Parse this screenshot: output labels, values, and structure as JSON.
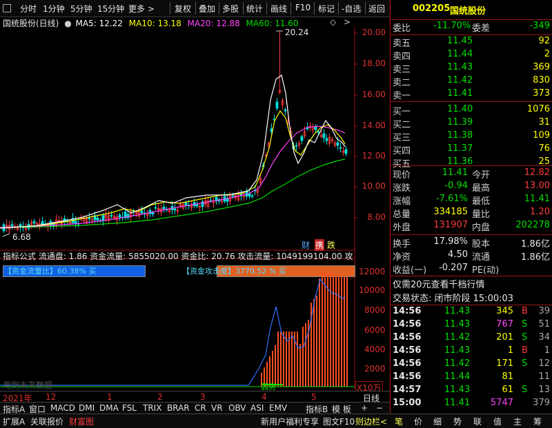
{
  "toolbar": {
    "left_items": [
      "分时",
      "1分钟",
      "5分钟",
      "15分钟",
      "更多 >"
    ],
    "right_items": [
      "复权",
      "叠加",
      "多股",
      "统计",
      "画线",
      "F10",
      "标记",
      "-自选",
      "返回"
    ]
  },
  "legend": {
    "stock_name": "国统股份(日线)",
    "ma5": "MA5: 12.22",
    "ma10": "MA10: 13.18",
    "ma20": "MA20: 12.88",
    "ma60": "MA60: 11.60"
  },
  "price_axis": [
    "20.00",
    "18.00",
    "16.00",
    "14.00",
    "12.00",
    "10.00",
    "8.00"
  ],
  "annotations": {
    "high_label": "20.24",
    "low_label": "6.68"
  },
  "badges": {
    "cai": "财",
    "xie": "携",
    "die": "跌"
  },
  "indicator": {
    "header": "指标公式 流通盘: 1.86 资金流量: 5855020.00 资金比: 20.76 攻击流量: 1049199104.00 攻击",
    "bar1_label": "【资金流量比】60.38% 买",
    "bar2_label": "【资金攻击度】3770.52 % 买",
    "watermark": "用到未来数据",
    "weak_label": "弱势",
    "axis": [
      "12000",
      "10000",
      "8000",
      "6000",
      "4000",
      "2000"
    ],
    "axis_unit": "X10万"
  },
  "time_axis": {
    "labels": [
      "2021年",
      "12",
      "1",
      "2",
      "3",
      "4",
      "5"
    ],
    "period": "日线"
  },
  "indicator_tabs": [
    "指标A",
    "窗口",
    "MACD",
    "DMI",
    "DMA",
    "FSL",
    "TRIX",
    "BRAR",
    "CR",
    "VR",
    "OBV",
    "ASI",
    "EMV",
    "指标B",
    "模 板",
    "+",
    "−"
  ],
  "bottom_tabs": [
    "扩展A",
    "关联报价",
    "财富图",
    "新用户福利专享",
    "图文F10",
    "则边栏<"
  ],
  "right_tabs": [
    "笔",
    "价",
    "细",
    "势",
    "联",
    "值",
    "主",
    "筹"
  ],
  "quote": {
    "code": "002205",
    "name": "国统股份",
    "weibi_label": "委比",
    "weibi": "-11.70%",
    "weicha_label": "委差",
    "weicha": "-349",
    "sell": [
      {
        "label": "卖五",
        "price": "11.45",
        "vol": "92"
      },
      {
        "label": "卖四",
        "price": "11.44",
        "vol": "2"
      },
      {
        "label": "卖三",
        "price": "11.43",
        "vol": "369"
      },
      {
        "label": "卖二",
        "price": "11.42",
        "vol": "830"
      },
      {
        "label": "卖一",
        "price": "11.41",
        "vol": "373"
      }
    ],
    "buy": [
      {
        "label": "买一",
        "price": "11.40",
        "vol": "1076"
      },
      {
        "label": "买二",
        "price": "11.39",
        "vol": "31"
      },
      {
        "label": "买三",
        "price": "11.38",
        "vol": "109"
      },
      {
        "label": "买四",
        "price": "11.37",
        "vol": "76"
      },
      {
        "label": "买五",
        "price": "11.36",
        "vol": "25"
      }
    ],
    "stats": [
      {
        "l1": "现价",
        "v1": "11.41",
        "l2": "今开",
        "v2": "12.82"
      },
      {
        "l1": "涨跌",
        "v1": "-0.94",
        "l2": "最高",
        "v2": "13.00"
      },
      {
        "l1": "涨幅",
        "v1": "-7.61%",
        "l2": "最低",
        "v2": "11.41"
      },
      {
        "l1": "总量",
        "v1": "334185",
        "l2": "量比",
        "v2": "1.20"
      },
      {
        "l1": "外盘",
        "v1": "131907",
        "l2": "内盘",
        "v2": "202278"
      }
    ],
    "stats2": [
      {
        "l1": "换手",
        "v1": "17.98%",
        "l2": "股本",
        "v2": "1.86亿"
      },
      {
        "l1": "净资",
        "v1": "4.50",
        "l2": "流通",
        "v2": "1.86亿"
      },
      {
        "l1": "收益(一)",
        "v1": "-0.207",
        "l2": "PE(动)",
        "v2": ""
      }
    ],
    "promo": "仅需20元查看千档行情",
    "status": "交易状态: 闭市阶段 15:00:03"
  },
  "ticks": [
    {
      "time": "14:56",
      "price": "11.43",
      "vol": "345",
      "bs": "B",
      "n": "39"
    },
    {
      "time": "14:56",
      "price": "11.43",
      "vol": "767",
      "bs": "S",
      "n": "51"
    },
    {
      "time": "14:56",
      "price": "11.42",
      "vol": "201",
      "bs": "S",
      "n": "34"
    },
    {
      "time": "14:56",
      "price": "11.43",
      "vol": "1",
      "bs": "B",
      "n": "1"
    },
    {
      "time": "14:56",
      "price": "11.42",
      "vol": "171",
      "bs": "S",
      "n": "12"
    },
    {
      "time": "14:56",
      "price": "11.44",
      "vol": "81",
      "bs": "",
      "n": "11"
    },
    {
      "time": "14:57",
      "price": "11.43",
      "vol": "61",
      "bs": "S",
      "n": "13"
    },
    {
      "time": "15:00",
      "price": "11.41",
      "vol": "5747",
      "bs": "",
      "n": "379"
    }
  ],
  "colors": {
    "up": "#ff3b3b",
    "down": "#00e000",
    "ma5": "#ffffff",
    "ma10": "#ffff00",
    "ma20": "#ff44ff",
    "ma60": "#00e000",
    "border": "#9b1515"
  }
}
